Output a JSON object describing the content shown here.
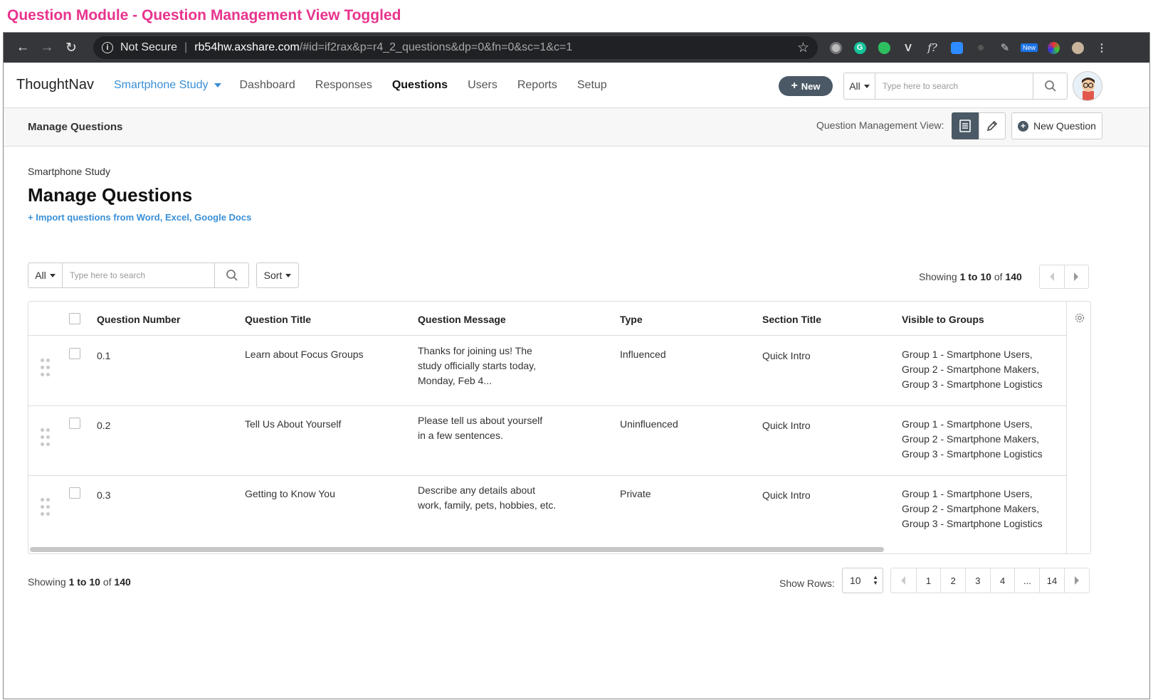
{
  "caption": "Question Module - Question Management View Toggled",
  "browser": {
    "security": "Not Secure",
    "url_host": "rb54hw.axshare.com",
    "url_path": "/#id=if2rax&p=r4_2_questions&dp=0&fn=0&sc=1&c=1",
    "ext_new_badge": "New"
  },
  "nav": {
    "logo": "ThoughtNav",
    "study": "Smartphone Study",
    "links": [
      "Dashboard",
      "Responses",
      "Questions",
      "Users",
      "Reports",
      "Setup"
    ],
    "active": "Questions",
    "new_button": "New",
    "search_scope": "All",
    "search_placeholder": "Type here to search"
  },
  "subheader": {
    "title": "Manage Questions",
    "view_label": "Question Management View:",
    "new_question": "New Question"
  },
  "main": {
    "study": "Smartphone Study",
    "title": "Manage Questions",
    "import_link": "+ Import questions from Word, Excel, Google Docs",
    "filter_scope": "All",
    "filter_placeholder": "Type here to search",
    "sort": "Sort",
    "showing_prefix": "Showing",
    "showing_range": "1 to 10",
    "showing_of": "of",
    "showing_total": "140"
  },
  "table": {
    "columns": [
      "Question Number",
      "Question Title",
      "Question Message",
      "Type",
      "Section Title",
      "Visible to Groups"
    ],
    "rows": [
      {
        "number": "0.1",
        "title": "Learn about Focus Groups",
        "message": "Thanks for joining us! The\nstudy officially starts today,\nMonday, Feb 4...",
        "type": "Influenced",
        "section": "Quick Intro",
        "groups": "Group 1 - Smartphone Users,\nGroup 2 - Smartphone Makers,\nGroup 3 - Smartphone Logistics"
      },
      {
        "number": "0.2",
        "title": "Tell Us About Yourself",
        "message": "Please tell us about yourself\nin a few sentences.",
        "type": "Uninfluenced",
        "section": "Quick Intro",
        "groups": "Group 1 - Smartphone Users,\nGroup 2 - Smartphone Makers,\nGroup 3 - Smartphone Logistics"
      },
      {
        "number": "0.3",
        "title": "Getting to Know You",
        "message": "Describe any details about\nwork, family, pets, hobbies, etc.",
        "type": "Private",
        "section": "Quick Intro",
        "groups": "Group 1 - Smartphone Users,\nGroup 2 - Smartphone Makers,\nGroup 3 - Smartphone Logistics"
      }
    ]
  },
  "footer": {
    "show_rows_label": "Show Rows:",
    "rows_value": "10",
    "pages": [
      "1",
      "2",
      "3",
      "4",
      "...",
      "14"
    ]
  },
  "colors": {
    "caption": "#e8338d",
    "accent": "#3a8fd6",
    "dark_button": "#4a5965"
  }
}
